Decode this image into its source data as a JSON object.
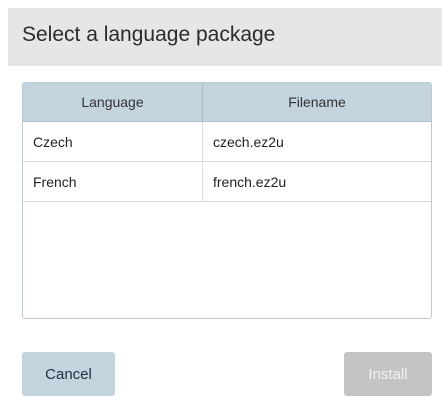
{
  "dialog": {
    "title": "Select a language package"
  },
  "table": {
    "columns": [
      "Language",
      "Filename"
    ],
    "rows": [
      {
        "language": "Czech",
        "filename": "czech.ez2u"
      },
      {
        "language": "French",
        "filename": "french.ez2u"
      }
    ]
  },
  "buttons": {
    "cancel_label": "Cancel",
    "install_label": "Install",
    "install_disabled": true
  },
  "colors": {
    "header_bg": "#e6e6e6",
    "table_header_bg": "#c3d4df",
    "cancel_bg": "#c3d4df",
    "install_disabled_bg": "#c4c4c4"
  }
}
